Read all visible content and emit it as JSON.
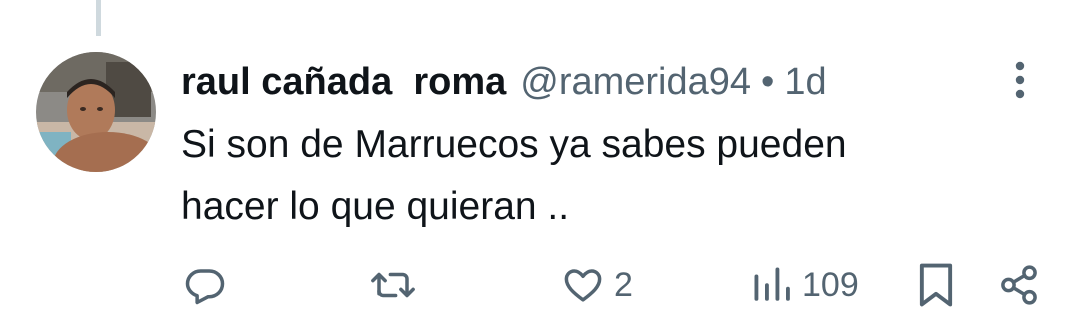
{
  "tweet": {
    "author": {
      "display_name": "raul cañada  roma",
      "handle": "@ramerida94",
      "separator": "•",
      "time": "1d",
      "avatar": "avatar-photo"
    },
    "text": "Si son de Marruecos ya sabes pueden\nhacer lo que quieran ..",
    "actions": {
      "reply": {
        "icon": "reply-icon",
        "count": ""
      },
      "retweet": {
        "icon": "retweet-icon",
        "count": ""
      },
      "like": {
        "icon": "heart-icon",
        "count": "2"
      },
      "views": {
        "icon": "views-icon",
        "count": "109"
      },
      "bookmark": {
        "icon": "bookmark-icon"
      },
      "share": {
        "icon": "share-icon"
      }
    },
    "more_icon": "more-vertical-icon"
  },
  "colors": {
    "text_primary": "#0f1419",
    "text_secondary": "#536471",
    "thread_line": "#cfd9de",
    "background": "#ffffff"
  }
}
